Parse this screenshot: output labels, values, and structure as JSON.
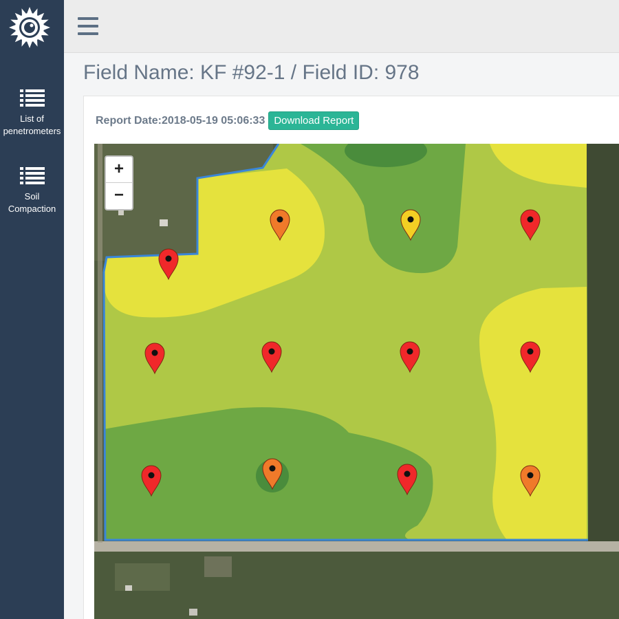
{
  "sidebar": {
    "logo": "sun-gear-logo",
    "items": [
      {
        "label_line1": "List of",
        "label_line2": "penetrometers",
        "icon": "list-icon"
      },
      {
        "label_line1": "Soil",
        "label_line2": "Compaction",
        "icon": "list-icon"
      }
    ]
  },
  "header": {
    "menu_icon": "hamburger-icon"
  },
  "page": {
    "title": "Field Name: KF #92-1 / Field ID: 978",
    "report_date": "Report Date:2018-05-19 05:06:33",
    "download_label": "Download Report"
  },
  "map": {
    "zoom_in": "+",
    "zoom_out": "−",
    "colors": {
      "yellow": "#e5e23d",
      "light_green": "#afc846",
      "mid_green": "#6ea844",
      "dark_green": "#4a8c3c",
      "boundary": "#3a86d8"
    },
    "markers": [
      {
        "color": "red"
      },
      {
        "color": "orange"
      },
      {
        "color": "yellow"
      },
      {
        "color": "red"
      },
      {
        "color": "red"
      },
      {
        "color": "red"
      },
      {
        "color": "red"
      },
      {
        "color": "red"
      },
      {
        "color": "red"
      },
      {
        "color": "orange"
      },
      {
        "color": "red"
      },
      {
        "color": "orange"
      }
    ],
    "marker_colors": {
      "red": "#f0282a",
      "orange": "#f07a2a",
      "yellow": "#f3cf24"
    }
  }
}
